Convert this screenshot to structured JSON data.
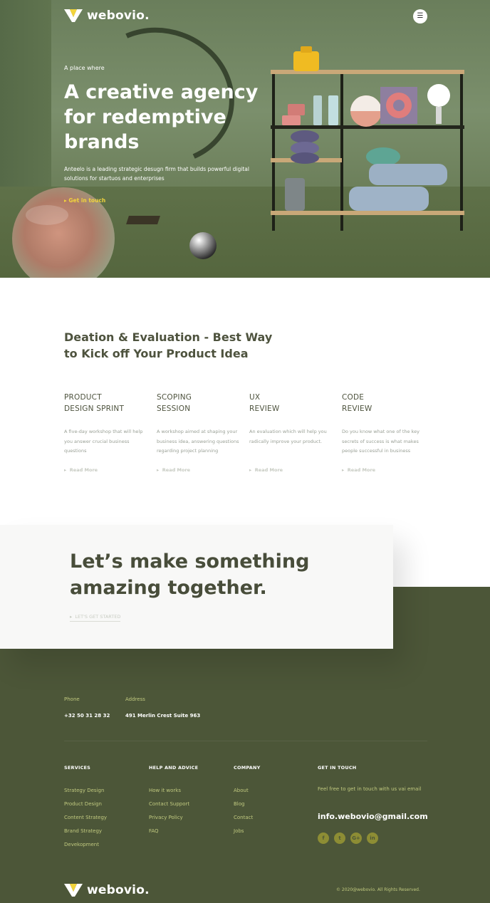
{
  "brand": {
    "name": "webovio.",
    "accent": "#f2d43c",
    "dark_green": "#4c5638"
  },
  "header": {
    "menu_icon": "menu-icon"
  },
  "hero": {
    "eyebrow": "A place where",
    "title_lines": [
      "A creative agency",
      "for redemptive",
      "brands"
    ],
    "description": "Anteelo is a leading strategic desugn firm that builds powerful digital solutions for startuos and enterprises",
    "cta": "Get in touch"
  },
  "process": {
    "title_lines": [
      "Deation & Evaluation - Best Way",
      "to Kick off Your Product Idea"
    ],
    "cards": [
      {
        "title_lines": [
          "PRODUCT",
          "DESIGN SPRINT"
        ],
        "text": "A five-day workshop that will help you answer crucial business questions",
        "link": "Read More"
      },
      {
        "title_lines": [
          "SCOPING",
          "SESSION"
        ],
        "text": "A workshop aimed at shaping your business idea, answering questions regarding project planning",
        "link": "Read More"
      },
      {
        "title_lines": [
          "UX",
          "REVIEW"
        ],
        "text": "An evaluation which will help you radically improve your product.",
        "link": "Read More"
      },
      {
        "title_lines": [
          "CODE",
          "REVIEW"
        ],
        "text": "Do you know what one of the key secrets of success is what makes people successful in business",
        "link": "Read More"
      }
    ]
  },
  "cta": {
    "title_lines": [
      "Let’s make something",
      "amazing together."
    ],
    "link": "LET'S GET STARTED"
  },
  "footer": {
    "phone_label": "Phone",
    "phone": "+32 50 31 28 32",
    "address_label": "Address",
    "address": "491 Merlin Crest Suite 963",
    "columns": [
      {
        "heading": "SERVICES",
        "items": [
          "Strategy Design",
          "Product Design",
          "Content Strategy",
          "Brand Strategy",
          "Devekopment"
        ]
      },
      {
        "heading": "HELP AND ADVICE",
        "items": [
          "How it works",
          "Contact Support",
          "Privacy Policy",
          "FAQ"
        ]
      },
      {
        "heading": "COMPANY",
        "items": [
          "About",
          "Blog",
          "Contact",
          "Jobs"
        ]
      }
    ],
    "touch": {
      "heading": "GET IN TOUCH",
      "text": "Feel free to get in touch with us vai email",
      "email": "info.webovio@gmail.com",
      "socials": [
        {
          "icon": "facebook-icon",
          "glyph": "f"
        },
        {
          "icon": "twitter-icon",
          "glyph": "t"
        },
        {
          "icon": "google-plus-icon",
          "glyph": "G+"
        },
        {
          "icon": "linkedin-icon",
          "glyph": "in"
        }
      ]
    },
    "copyright": "© 2020@webovio. All Rights Reserved."
  }
}
